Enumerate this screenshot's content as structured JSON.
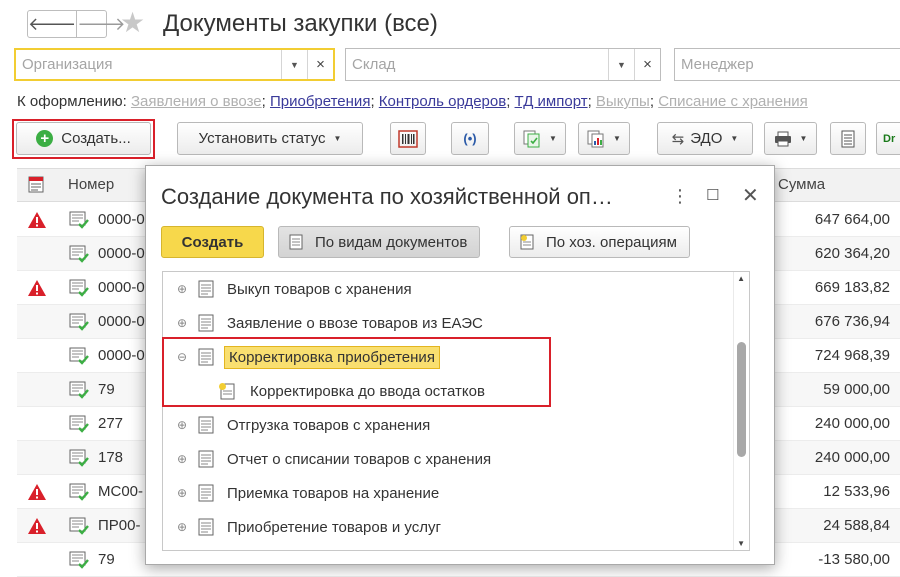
{
  "header": {
    "title": "Документы закупки (все)",
    "back_icon": "arrow-left-icon",
    "forward_icon": "arrow-right-icon",
    "favorite_icon": "star-icon"
  },
  "filters": {
    "organization_placeholder": "Организация",
    "warehouse_placeholder": "Склад",
    "manager_placeholder": "Менеджер"
  },
  "links": {
    "label": "К оформлению:",
    "items": [
      {
        "text": "Заявления о ввозе",
        "active": false
      },
      {
        "text": "Приобретения",
        "active": true
      },
      {
        "text": "Контроль ордеров",
        "active": true
      },
      {
        "text": "ТД импорт",
        "active": true
      },
      {
        "text": "Выкупы",
        "active": false
      },
      {
        "text": "Списание с хранения",
        "active": false
      }
    ]
  },
  "toolbar": {
    "create_label": "Создать...",
    "set_status_label": "Установить статус",
    "edo_label": "ЭДО",
    "dr_label": "Dr"
  },
  "table": {
    "col_number": "Номер",
    "col_sum": "Сумма",
    "rows": [
      {
        "warn": true,
        "number": "0000-0",
        "sum": "647 664,00"
      },
      {
        "warn": false,
        "number": "0000-0",
        "sum": "620 364,20"
      },
      {
        "warn": true,
        "number": "0000-0",
        "sum": "669 183,82"
      },
      {
        "warn": false,
        "number": "0000-0",
        "sum": "676 736,94"
      },
      {
        "warn": false,
        "number": "0000-0",
        "sum": "724 968,39"
      },
      {
        "warn": false,
        "number": "79",
        "sum": "59 000,00"
      },
      {
        "warn": false,
        "number": "277",
        "sum": "240 000,00"
      },
      {
        "warn": false,
        "number": "178",
        "sum": "240 000,00"
      },
      {
        "warn": true,
        "number": "МС00-",
        "sum": "12 533,96"
      },
      {
        "warn": true,
        "number": "ПР00-",
        "sum": "24 588,84"
      },
      {
        "warn": false,
        "number": "79",
        "sum": "-13 580,00"
      }
    ]
  },
  "dialog": {
    "title": "Создание документа по хозяйственной оп…",
    "more_icon": "more-vertical-icon",
    "maximize_icon": "maximize-icon",
    "close_icon": "close-icon",
    "create_label": "Создать",
    "by_doc_types_label": "По видам документов",
    "by_operations_label": "По хоз. операциям",
    "tree": [
      {
        "label": "Выкуп товаров с хранения",
        "toggle": "⊕",
        "level": 0,
        "selected": false
      },
      {
        "label": "Заявление о ввозе товаров из ЕАЭС",
        "toggle": "⊕",
        "level": 0,
        "selected": false
      },
      {
        "label": "Корректировка приобретения",
        "toggle": "⊖",
        "level": 0,
        "selected": true
      },
      {
        "label": "Корректировка до ввода остатков",
        "toggle": "",
        "level": 1,
        "selected": false
      },
      {
        "label": "Отгрузка товаров с хранения",
        "toggle": "⊕",
        "level": 0,
        "selected": false
      },
      {
        "label": "Отчет о списании товаров с хранения",
        "toggle": "⊕",
        "level": 0,
        "selected": false
      },
      {
        "label": "Приемка товаров на хранение",
        "toggle": "⊕",
        "level": 0,
        "selected": false
      },
      {
        "label": "Приобретение товаров и услуг",
        "toggle": "⊕",
        "level": 0,
        "selected": false
      }
    ]
  },
  "colors": {
    "accent_yellow": "#f7d84b",
    "highlight_red": "#d9202a",
    "warning_red": "#d9202a",
    "success_green": "#3cae44",
    "link_blue": "#3a3a9a"
  }
}
